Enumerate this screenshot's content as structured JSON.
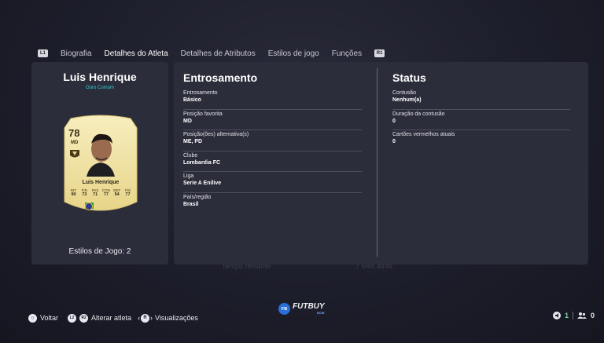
{
  "colors": {
    "accent_teal": "#2fd3d8",
    "panel": "#2c2d3b",
    "card_gold": "#f2e6a6",
    "logo_blue": "#2a6fd8",
    "counter_green": "#7dd3a0"
  },
  "background_hints": [
    "Tempo restante",
    "7 Mês atrás"
  ],
  "nav": {
    "left_button": "L1",
    "right_button": "R1",
    "tabs": [
      {
        "label": "Biografia",
        "active": false
      },
      {
        "label": "Detalhes do Atleta",
        "active": true
      },
      {
        "label": "Detalhes de Atributos",
        "active": false
      },
      {
        "label": "Estilos de jogo",
        "active": false
      },
      {
        "label": "Funções",
        "active": false
      }
    ]
  },
  "player": {
    "name": "Luis Henrique",
    "rarity": "Ouro Comum",
    "card": {
      "rating": "78",
      "position": "MD",
      "name": "Luis Henrique",
      "stats": [
        {
          "label": "RIT",
          "value": "90"
        },
        {
          "label": "FIN",
          "value": "73"
        },
        {
          "label": "PAS",
          "value": "71"
        },
        {
          "label": "CON",
          "value": "77"
        },
        {
          "label": "DEF",
          "value": "54"
        },
        {
          "label": "FÍS",
          "value": "77"
        }
      ]
    },
    "playstyles_label": "Estilos de Jogo: 2"
  },
  "entrosamento": {
    "title": "Entrosamento",
    "fields": [
      {
        "label": "Entrosamento",
        "value": "Básico"
      },
      {
        "label": "Posição favorita",
        "value": "MD"
      },
      {
        "label": "Posição(ões) alternativa(s)",
        "value": "ME, PD"
      },
      {
        "label": "Clube",
        "value": "Lombardia FC"
      },
      {
        "label": "Liga",
        "value": "Serie A Enilive"
      },
      {
        "label": "País/região",
        "value": "Brasil"
      }
    ]
  },
  "status": {
    "title": "Status",
    "fields": [
      {
        "label": "Contusão",
        "value": "Nenhum(a)"
      },
      {
        "label": "Duração da contusão",
        "value": "0"
      },
      {
        "label": "Cartões vermelhos atuais",
        "value": "0"
      }
    ]
  },
  "footer": {
    "back_label": "Voltar",
    "change_player_label": "Alterar atleta",
    "views_label": "Visualizações",
    "l2": "L2",
    "r2": "R2",
    "r3": "R"
  },
  "logo": {
    "text": "FUTBUY",
    "sub": "NOW",
    "badge": "FB"
  },
  "counters": {
    "first": "1",
    "second": "0"
  }
}
